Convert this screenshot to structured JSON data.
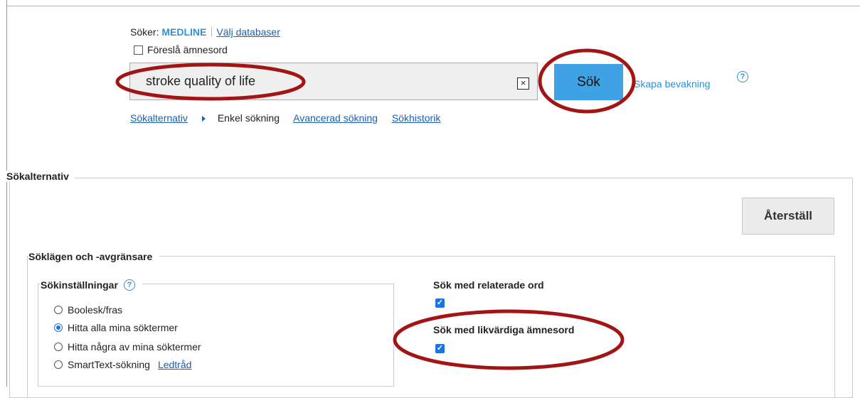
{
  "database_line": {
    "prefix": "Söker:",
    "database": "MEDLINE",
    "choose_link": "Välj databaser"
  },
  "suggest_subject_terms": {
    "label": "Föreslå ämnesord",
    "checked": false
  },
  "search": {
    "value": "stroke quality of life",
    "clear_symbol": "×",
    "button_label": "Sök"
  },
  "create_alert": {
    "label": "Skapa bevakning",
    "help_glyph": "?"
  },
  "search_nav": {
    "options_link": "Sökalternativ",
    "basic": "Enkel sökning",
    "advanced": "Avancerad sökning",
    "history": "Sökhistorik"
  },
  "options_panel": {
    "title": "Sökalternativ",
    "reset_label": "Återställ",
    "modes_title": "Söklägen och -avgränsare",
    "settings_title": "Sökinställningar",
    "settings_help_glyph": "?",
    "modes": [
      {
        "label": "Boolesk/fras",
        "selected": false
      },
      {
        "label": "Hitta alla mina söktermer",
        "selected": true
      },
      {
        "label": "Hitta några av mina söktermer",
        "selected": false
      },
      {
        "label": "SmartText-sökning",
        "selected": false,
        "hint_link": "Ledtråd"
      }
    ],
    "related_words": {
      "label": "Sök med relaterade ord",
      "checked": true
    },
    "equivalent_subjects": {
      "label": "Sök med likvärdiga ämnesord",
      "checked": true
    }
  },
  "colors": {
    "accent": "#3ea2e5",
    "link": "#1a5fb4",
    "annotation": "#a31515"
  }
}
